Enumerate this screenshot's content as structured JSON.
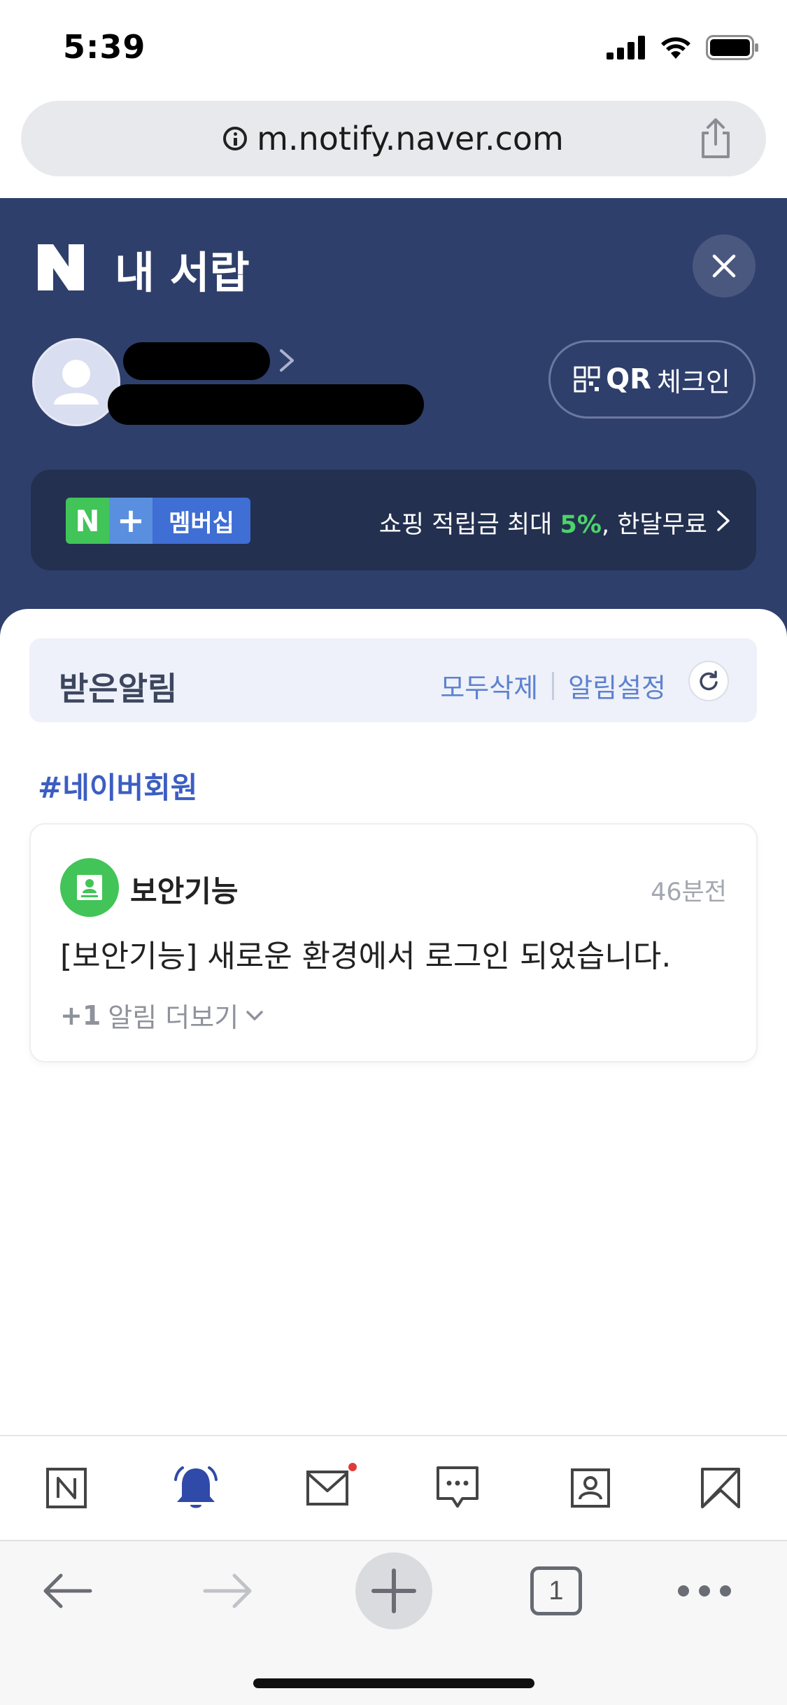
{
  "status_bar": {
    "time": "5:39",
    "icons": [
      "signal-icon",
      "wifi-icon",
      "battery-icon"
    ]
  },
  "browser": {
    "url": "m.notify.naver.com",
    "share_icon": "share-icon",
    "info_icon": "info-icon"
  },
  "drawer": {
    "title": "내 서랍",
    "logo_letter": "N",
    "close_icon": "close-icon",
    "qr_button": {
      "bold": "QR",
      "label": "체크인"
    },
    "membership": {
      "badge_n": "N",
      "badge_plus": "+",
      "badge_text": "멤버십",
      "promo_prefix": "쇼핑 적립금 최대 ",
      "promo_highlight": "5%",
      "promo_suffix": ", 한달무료"
    }
  },
  "notifications": {
    "title": "받은알림",
    "delete_all": "모두삭제",
    "settings": "알림설정",
    "group_tag": "#네이버회원",
    "items": [
      {
        "source": "보안기능",
        "time": "46분전",
        "message": "[보안기능] 새로운 환경에서 로그인 되었습니다.",
        "more_count": "+1",
        "more_label": "알림 더보기"
      }
    ]
  },
  "app_nav": [
    "naver-home-icon",
    "bell-icon",
    "mail-icon",
    "talk-icon",
    "contacts-icon",
    "bookmark-icon"
  ],
  "safari_toolbar": {
    "tab_count": "1",
    "icons": [
      "back-icon",
      "forward-icon",
      "new-tab-icon",
      "tabs-icon",
      "more-icon"
    ]
  },
  "colors": {
    "drawer_bg": "#2f3f6b",
    "accent_blue": "#3c5ec2",
    "naver_green": "#42c458",
    "promo_green": "#4bd468"
  }
}
